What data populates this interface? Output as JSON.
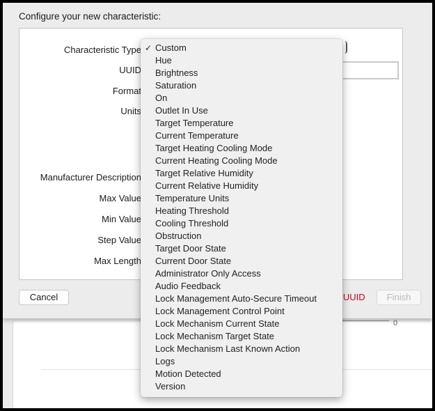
{
  "dialog": {
    "title": "Configure your new characteristic:",
    "labels": {
      "characteristic_type": "Characteristic Type",
      "uuid": "UUID",
      "format": "Format",
      "units": "Units",
      "manufacturer_description": "Manufacturer Description",
      "max_value": "Max Value",
      "min_value": "Min Value",
      "step_value": "Step Value",
      "max_length": "Max Length"
    },
    "uuid_value": "",
    "error_text": "a UUID",
    "buttons": {
      "cancel": "Cancel",
      "finish": "Finish"
    },
    "accent_error_color": "#d0021b"
  },
  "background": {
    "value_label": "0"
  },
  "characteristic_type_menu": {
    "selected": "Custom",
    "check_glyph": "✓",
    "items": [
      "Custom",
      "Hue",
      "Brightness",
      "Saturation",
      "On",
      "Outlet In Use",
      "Target Temperature",
      "Current Temperature",
      "Target Heating Cooling Mode",
      "Current Heating Cooling Mode",
      "Target Relative Humidity",
      "Current Relative Humidity",
      "Temperature Units",
      "Heating Threshold",
      "Cooling Threshold",
      "Obstruction",
      "Target Door State",
      "Current Door State",
      "Administrator Only Access",
      "Audio Feedback",
      "Lock Management Auto-Secure Timeout",
      "Lock Management Control Point",
      "Lock Mechanism Current State",
      "Lock Mechanism Target State",
      "Lock Mechanism Last Known Action",
      "Logs",
      "Motion Detected",
      "Version"
    ]
  }
}
